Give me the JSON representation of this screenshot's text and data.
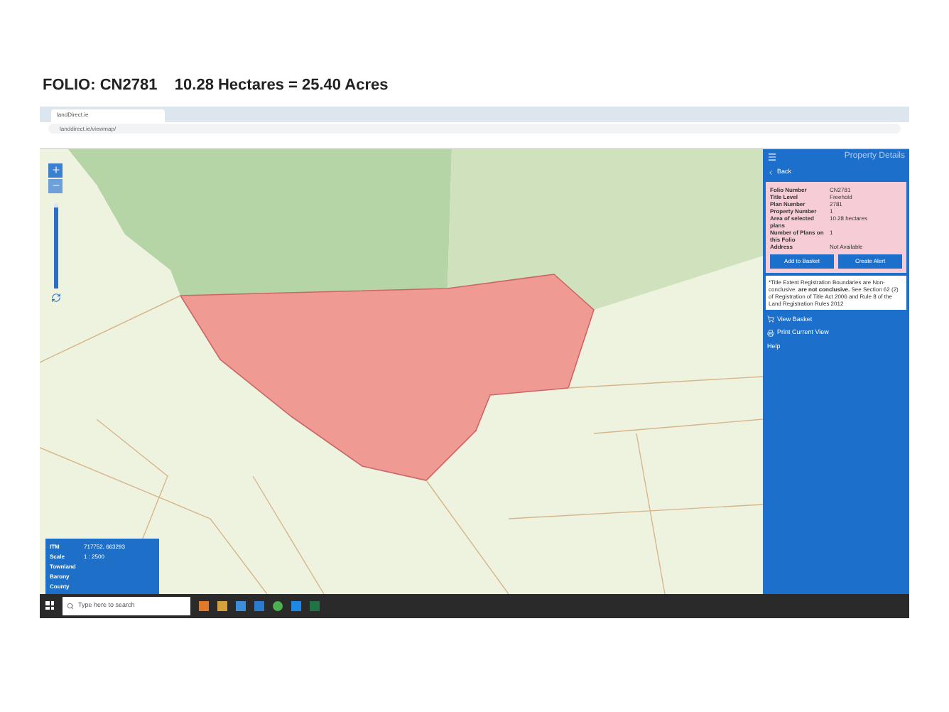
{
  "heading": "FOLIO: CN2781    10.28 Hectares = 25.40 Acres",
  "browser": {
    "tab_title": "landDirect.ie",
    "url": "landdirect.ie/viewmap/"
  },
  "map": {
    "zoom": {
      "level": 0.95
    }
  },
  "panel": {
    "title": "Property Details",
    "back": "Back",
    "fields": [
      {
        "label": "Folio Number",
        "value": "CN2781"
      },
      {
        "label": "Title Level",
        "value": "Freehold"
      },
      {
        "label": "Plan Number",
        "value": "2781"
      },
      {
        "label": "Property Number",
        "value": "1"
      },
      {
        "label": "Area of selected plans",
        "value": "10.28 hectares"
      },
      {
        "label": "Number of Plans on this Folio",
        "value": "1"
      },
      {
        "label": "Address",
        "value": "Not Available"
      }
    ],
    "buttons": [
      "Add to Basket",
      "Create Alert"
    ],
    "notice": "*Title Extent Registration Boundaries are Non-conclusive. **are not conclusive.** See Section 62 (2) of Registration of Title Act 2006 and Rule 8 of the Land Registration Rules 2012",
    "links": [
      {
        "kind": "basket",
        "label": "View Basket"
      },
      {
        "kind": "print",
        "label": "Print Current View"
      },
      {
        "kind": "plain",
        "label": "Help"
      }
    ]
  },
  "info": [
    {
      "label": "ITM",
      "value": "717752, 663293"
    },
    {
      "label": "Scale",
      "value": "1 : 2500"
    },
    {
      "label": "Townland"
    },
    {
      "label": "Barony"
    },
    {
      "label": "County"
    }
  ],
  "taskbar": {
    "search_placeholder": "Type here to search"
  }
}
